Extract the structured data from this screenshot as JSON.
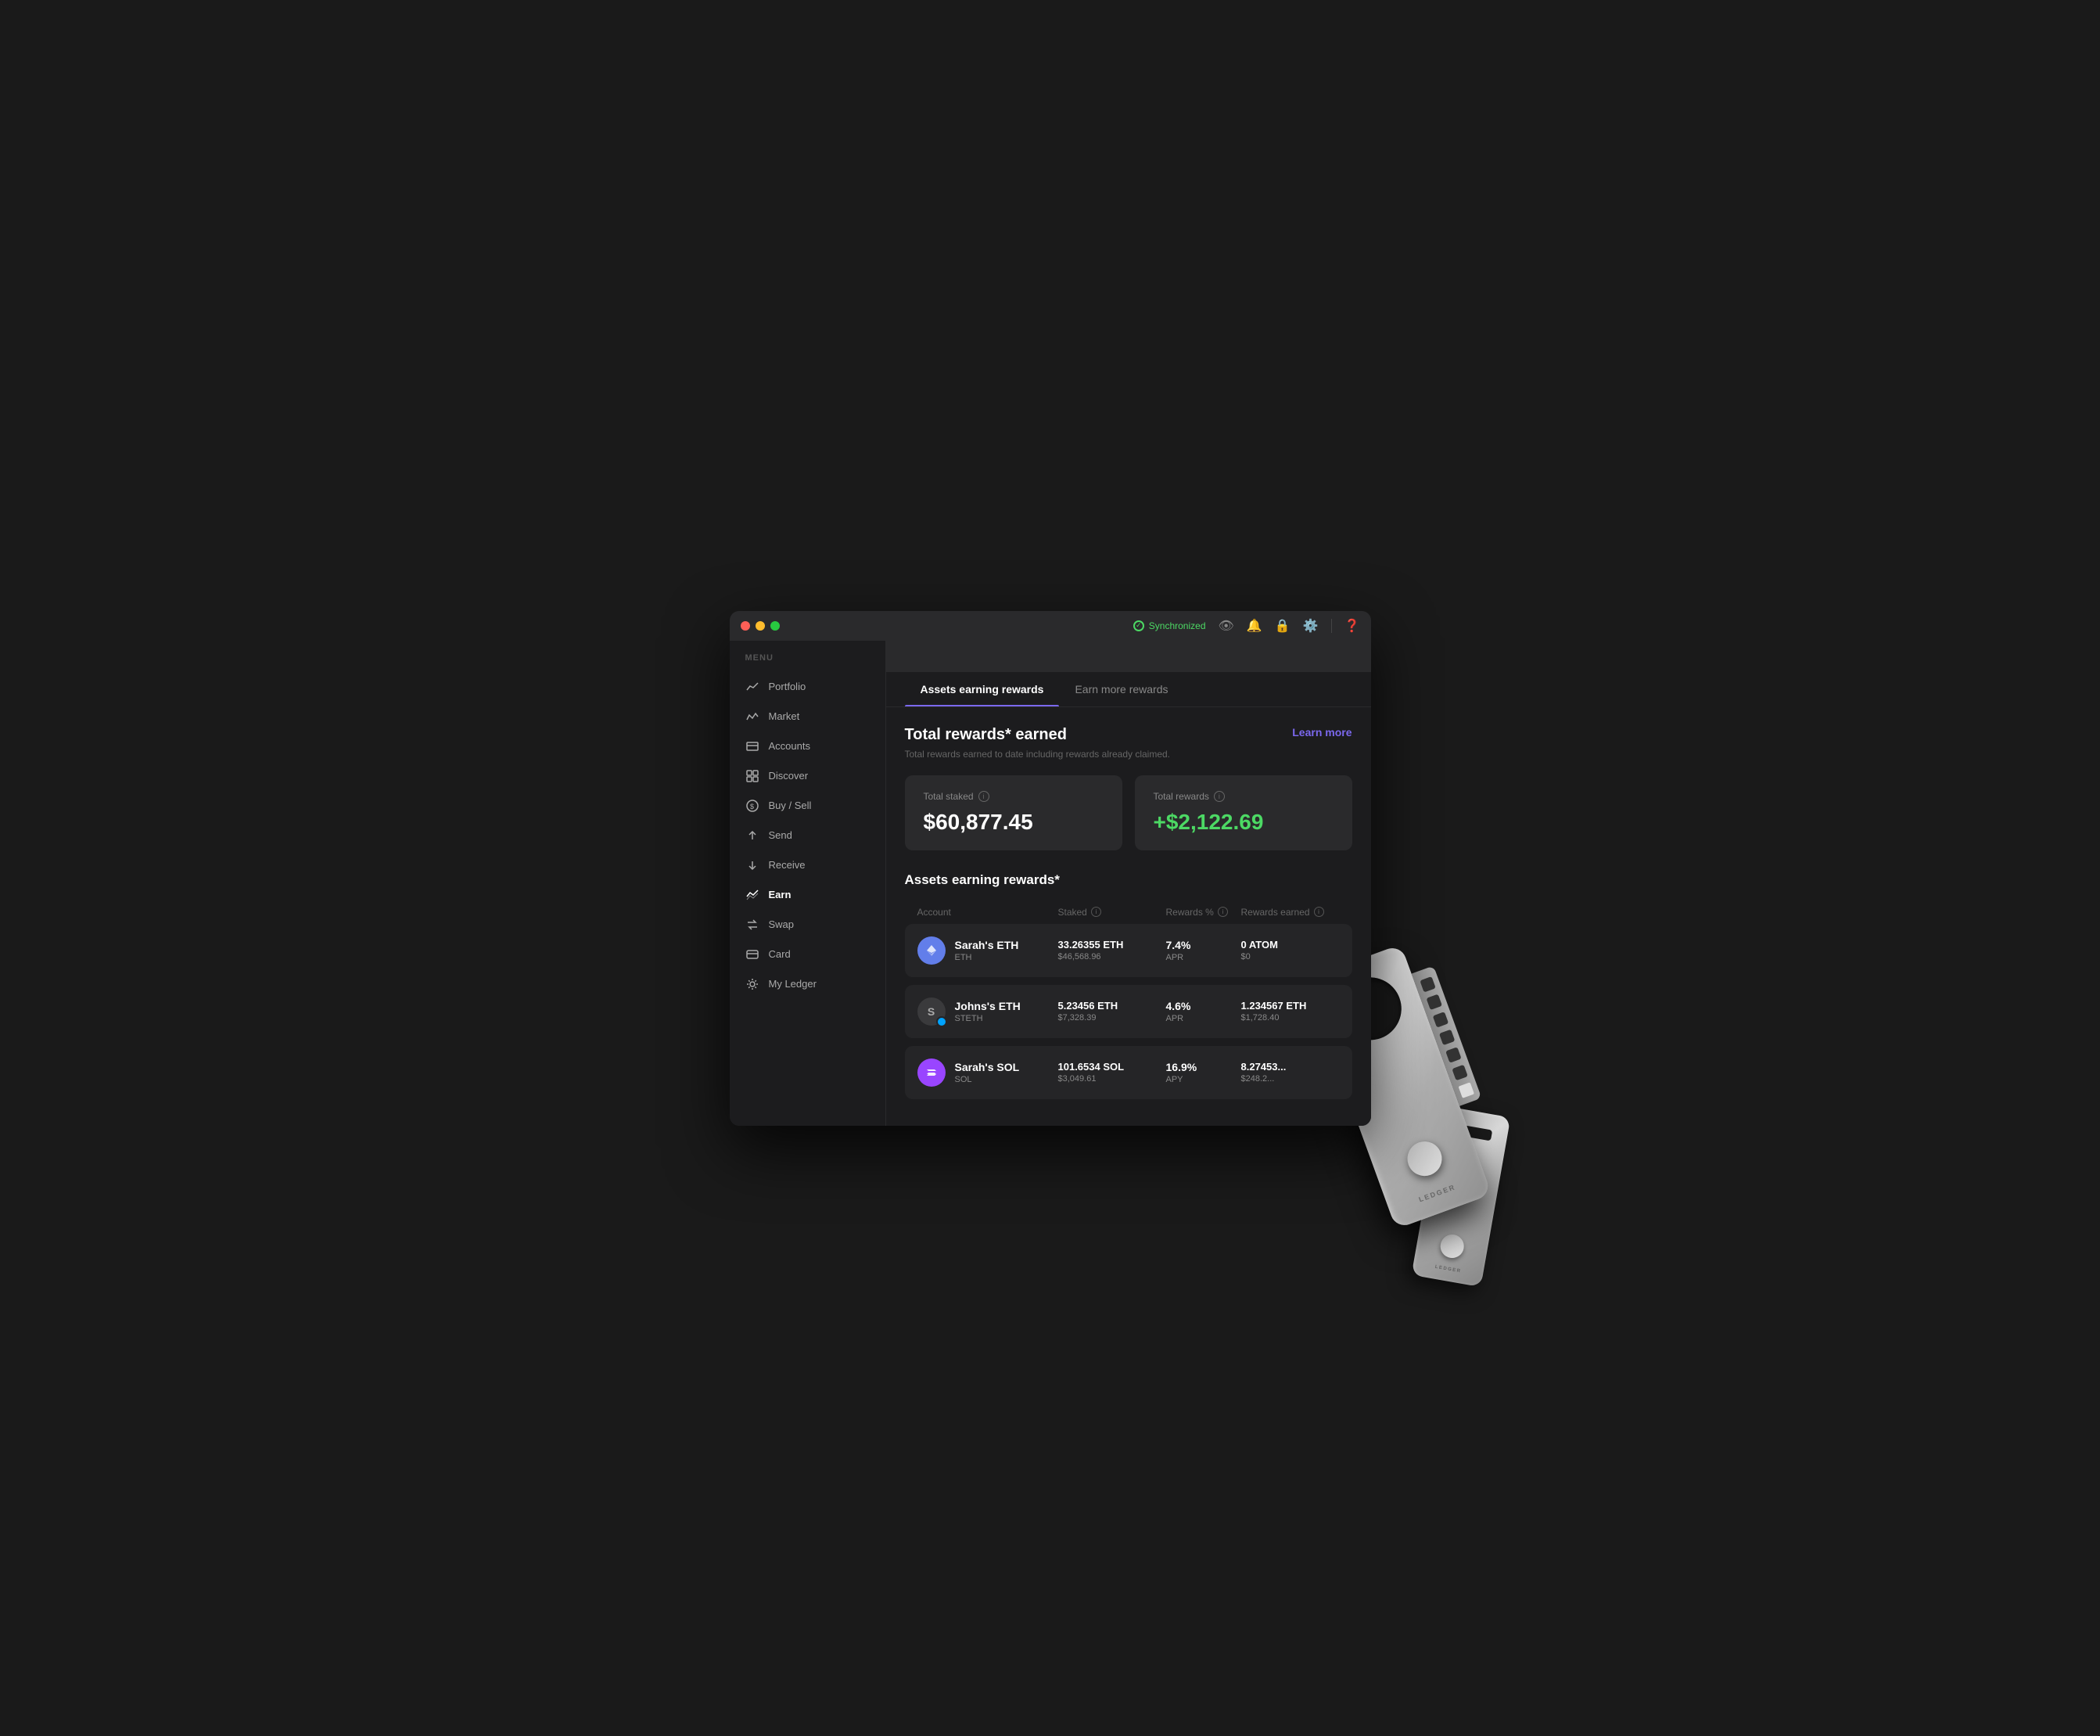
{
  "window": {
    "traffic_lights": [
      "red",
      "yellow",
      "green"
    ],
    "sync_label": "Synchronized",
    "menu_label": "MENU"
  },
  "sidebar": {
    "items": [
      {
        "id": "portfolio",
        "label": "Portfolio",
        "icon": "📈"
      },
      {
        "id": "market",
        "label": "Market",
        "icon": "📊"
      },
      {
        "id": "accounts",
        "label": "Accounts",
        "icon": "🗃️"
      },
      {
        "id": "discover",
        "label": "Discover",
        "icon": "🔲"
      },
      {
        "id": "buy-sell",
        "label": "Buy / Sell",
        "icon": "💲"
      },
      {
        "id": "send",
        "label": "Send",
        "icon": "⬆️"
      },
      {
        "id": "receive",
        "label": "Receive",
        "icon": "⬇️"
      },
      {
        "id": "earn",
        "label": "Earn",
        "icon": "📉"
      },
      {
        "id": "swap",
        "label": "Swap",
        "icon": "🔄"
      },
      {
        "id": "card",
        "label": "Card",
        "icon": "💳"
      },
      {
        "id": "my-ledger",
        "label": "My Ledger",
        "icon": "⚙️"
      }
    ]
  },
  "tabs": [
    {
      "id": "assets-earning",
      "label": "Assets earning rewards",
      "active": true
    },
    {
      "id": "earn-more",
      "label": "Earn more rewards",
      "active": false
    }
  ],
  "rewards": {
    "title": "Total rewards* earned",
    "subtitle": "Total rewards earned to date including rewards already claimed.",
    "learn_more": "Learn more",
    "total_staked_label": "Total staked",
    "total_staked_value": "$60,877.45",
    "total_rewards_label": "Total rewards",
    "total_rewards_value": "+$2,122.69"
  },
  "assets_section": {
    "title": "Assets earning rewards*",
    "columns": [
      "Account",
      "Staked",
      "Rewards %",
      "Rewards earned"
    ],
    "rows": [
      {
        "account_name": "Sarah's ETH",
        "ticker": "ETH",
        "icon_bg": "#627EEA",
        "icon_symbol": "◆",
        "staked_amount": "33.26355 ETH",
        "staked_usd": "$46,568.96",
        "rewards_pct": "7.4%",
        "rewards_type": "APR",
        "rewards_earned": "0 ATOM",
        "rewards_earned_usd": "$0"
      },
      {
        "account_name": "Johns's ETH",
        "ticker": "STETH",
        "icon_bg": "#3a3a3c",
        "icon_symbol": "S",
        "staked_amount": "5.23456 ETH",
        "staked_usd": "$7,328.39",
        "rewards_pct": "4.6%",
        "rewards_type": "APR",
        "rewards_earned": "1.234567 ETH",
        "rewards_earned_usd": "$1,728.40"
      },
      {
        "account_name": "Sarah's SOL",
        "ticker": "SOL",
        "icon_bg": "#9945FF",
        "icon_symbol": "◎",
        "staked_amount": "101.6534 SOL",
        "staked_usd": "$3,049.61",
        "rewards_pct": "16.9%",
        "rewards_type": "APY",
        "rewards_earned": "8.27453...",
        "rewards_earned_usd": "$248.2..."
      }
    ]
  },
  "colors": {
    "accent": "#7B68EE",
    "green": "#4cd964",
    "bg_dark": "#1c1c1e",
    "bg_card": "#2a2a2c",
    "bg_row": "#252527",
    "text_primary": "#ffffff",
    "text_secondary": "#888888"
  }
}
